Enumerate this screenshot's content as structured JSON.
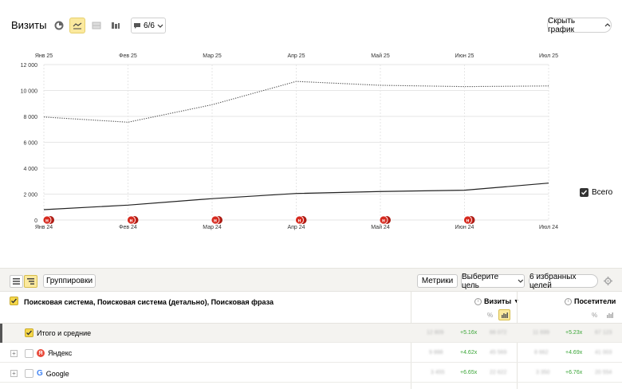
{
  "header": {
    "title": "Визиты",
    "segments_count": "6/6",
    "hide_chart_label": "Скрыть график"
  },
  "colors": {
    "accent_yellow": "#fbe99e",
    "line_current": "#222222",
    "line_prev": "#444444",
    "annotation_red": "#d62b20",
    "green_delta": "#3aa537"
  },
  "chart_data": {
    "type": "line",
    "x_top": [
      "Янв 25",
      "Фев 25",
      "Мар 25",
      "Апр 25",
      "Май 25",
      "Июн 25",
      "Июл 25"
    ],
    "x_bottom": [
      "Янв 24",
      "Фев 24",
      "Мар 24",
      "Апр 24",
      "Май 24",
      "Июн 24",
      "Июл 24"
    ],
    "y_ticks": [
      0,
      2000,
      4000,
      6000,
      8000,
      10000,
      12000
    ],
    "y_tick_labels": [
      "0",
      "2 000",
      "4 000",
      "6 000",
      "8 000",
      "10 000",
      "12 000"
    ],
    "ylim": [
      0,
      12000
    ],
    "grid": true,
    "series": [
      {
        "values": [
          7950,
          7550,
          8900,
          10700,
          10400,
          10300,
          10350
        ],
        "style": "dotted"
      },
      {
        "values": [
          800,
          1150,
          1650,
          2050,
          2200,
          2300,
          2850
        ],
        "style": "solid"
      }
    ],
    "annotations_at": [
      0,
      1,
      2,
      3,
      4,
      5
    ],
    "annotation_text": "н",
    "legend": {
      "label": "Всего",
      "placement": "right"
    }
  },
  "toolbar": {
    "groupings_label": "Группировки",
    "metrics_label": "Метрики",
    "goal_label": "Выберите цель",
    "favorites_label": "6 избранных целей"
  },
  "table": {
    "dimension_title": "Поисковая система, Поисковая система (детально), Поисковая фраза",
    "columns": [
      {
        "title": "Визиты",
        "sort": "▼"
      },
      {
        "title": "Посетители"
      }
    ],
    "rows": [
      {
        "label": "Итого и средние",
        "v1": "12 809",
        "d1": "+5.16x",
        "v2": "66 072",
        "v3": "11 699",
        "d2": "+5.23x",
        "v4": "67 123"
      },
      {
        "label": "Яндекс",
        "v1": "9 888",
        "d1": "+4.62x",
        "v2": "45 569",
        "v3": "8 662",
        "d2": "+4.69x",
        "v4": "41 003"
      },
      {
        "label": "Google",
        "v1": "3 455",
        "d1": "+6.65x",
        "v2": "22 622",
        "v3": "3 350",
        "d2": "+6.76x",
        "v4": "20 554"
      }
    ]
  }
}
